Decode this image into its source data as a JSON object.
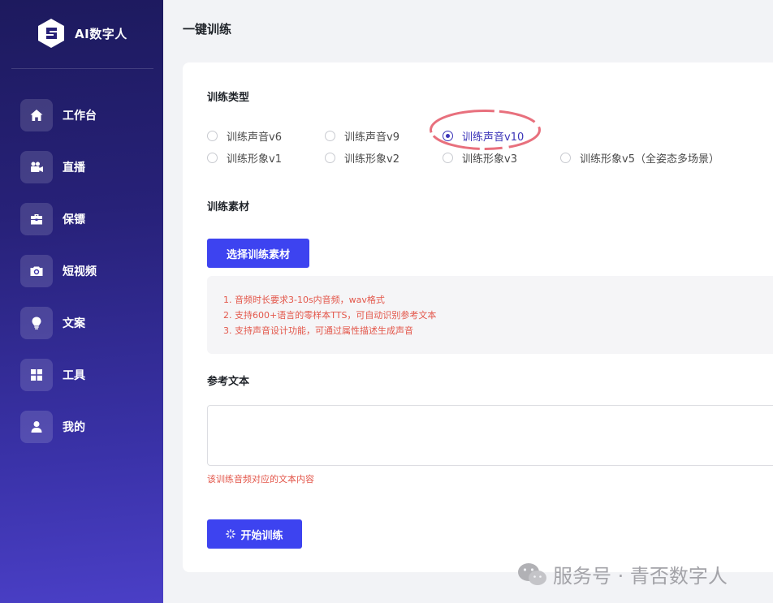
{
  "app": {
    "name": "AI数字人"
  },
  "sidebar": {
    "items": [
      {
        "label": "工作台",
        "icon": "home-icon"
      },
      {
        "label": "直播",
        "icon": "video-camera-icon"
      },
      {
        "label": "保镖",
        "icon": "briefcase-icon"
      },
      {
        "label": "短视频",
        "icon": "camera-icon"
      },
      {
        "label": "文案",
        "icon": "lightbulb-icon"
      },
      {
        "label": "工具",
        "icon": "grid-icon"
      },
      {
        "label": "我的",
        "icon": "user-icon"
      }
    ]
  },
  "page": {
    "title": "一键训练"
  },
  "training_type": {
    "label": "训练类型",
    "options": [
      {
        "label": "训练声音v6",
        "checked": false
      },
      {
        "label": "训练声音v9",
        "checked": false
      },
      {
        "label": "训练声音v10",
        "checked": true
      },
      {
        "label": "训练形象v1",
        "checked": false
      },
      {
        "label": "训练形象v2",
        "checked": false
      },
      {
        "label": "训练形象v3",
        "checked": false
      },
      {
        "label": "训练形象v5（全姿态多场景）",
        "checked": false
      }
    ]
  },
  "material": {
    "label": "训练素材",
    "button": "选择训练素材",
    "tips": [
      "1. 音频时长要求3-10s内音频，wav格式",
      "2. 支持600+语言的零样本TTS，可自动识别参考文本",
      "3. 支持声音设计功能，可通过属性描述生成声音"
    ]
  },
  "reference": {
    "label": "参考文本",
    "value": "",
    "hint": "该训练音频对应的文本内容"
  },
  "start_button": "开始训练",
  "watermark": "服务号 · 青否数字人",
  "colors": {
    "primary": "#3d43f0",
    "accent": "#3b34b8",
    "tip": "#e3564a",
    "annotation": "#e8707d"
  }
}
